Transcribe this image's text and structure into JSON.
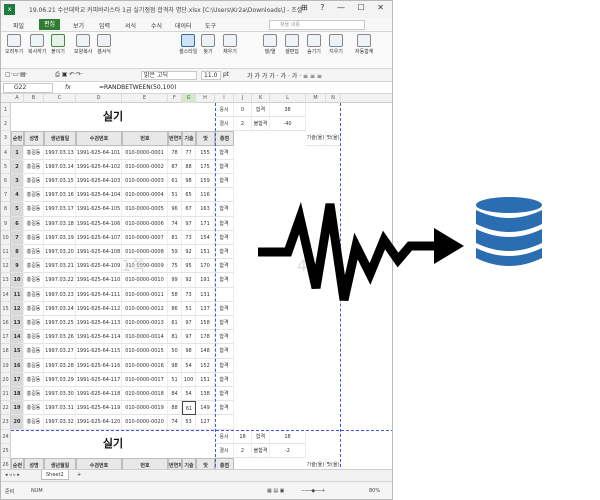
{
  "window": {
    "title": "19.06.21 수산대학교 커피바리스타 1급 실기점점 합격자 명단.xlsx [C:\\Users\\Kr2a\\Downloads\\] - 조셀",
    "logo": "x",
    "controls": "⊞ ? — ☐ ✕"
  },
  "menu": {
    "items": [
      "파일",
      "편집",
      "보기",
      "입력",
      "서식",
      "수식",
      "데이터",
      "도구"
    ],
    "active_index": 1,
    "quick_placeholder": "찾을 내용"
  },
  "ribbon": {
    "buttons": [
      "오려두기",
      "복사하기",
      "붙이기",
      "모양복사",
      "셀서식",
      "셀스타일",
      "찾기",
      "채우기",
      "행/열",
      "셀편집",
      "숨기기",
      "지우기",
      "자동합계"
    ]
  },
  "toolbar": {
    "font": "맑은 고딕",
    "size": "11.0",
    "unit": "pt"
  },
  "formula_bar": {
    "cell_ref": "G22",
    "fx": "fx",
    "formula": "=RANDBETWEEN(50,100)"
  },
  "columns": [
    "A",
    "B",
    "C",
    "D",
    "E",
    "F",
    "G",
    "H",
    "I",
    "J",
    "K",
    "L",
    "M",
    "N"
  ],
  "sheet": {
    "title": "실기",
    "watermark_left": "1쪽",
    "watermark_right": "4쪽",
    "side_labels": {
      "r1": [
        "응시",
        "0",
        "합격",
        "38"
      ],
      "r2": [
        "결시",
        "2",
        "불합격",
        "-40"
      ],
      "r3": [
        "기술(율)",
        "맛(율)"
      ]
    },
    "headers": [
      "순번",
      "성명",
      "생년월일",
      "수검번호",
      "번호",
      "번연처",
      "기술",
      "맛",
      "총점"
    ],
    "rows": [
      [
        "1",
        "홍길동",
        "1997.03.13",
        "1991-625-64-101",
        "010-0000-0001",
        "78",
        "77",
        "155",
        "합격"
      ],
      [
        "2",
        "홍길동",
        "1997.03.14",
        "1991-625-64-102",
        "010-0000-0002",
        "87",
        "88",
        "175",
        "합격"
      ],
      [
        "3",
        "홍길동",
        "1997.03.15",
        "1991-625-64-103",
        "010-0000-0003",
        "61",
        "98",
        "159",
        "합격"
      ],
      [
        "4",
        "홍길동",
        "1997.03.16",
        "1991-625-64-104",
        "010-0000-0004",
        "51",
        "65",
        "116",
        ""
      ],
      [
        "5",
        "홍길동",
        "1997.03.17",
        "1991-625-64-105",
        "010-0000-0005",
        "96",
        "67",
        "163",
        "합격"
      ],
      [
        "6",
        "홍길동",
        "1997.03.18",
        "1991-625-64-106",
        "010-0000-0006",
        "74",
        "97",
        "171",
        "합격"
      ],
      [
        "7",
        "홍길동",
        "1997.03.19",
        "1991-625-64-107",
        "010-0000-0007",
        "81",
        "73",
        "154",
        "합격"
      ],
      [
        "8",
        "홍길동",
        "1997.03.20",
        "1991-625-64-108",
        "010-0000-0008",
        "59",
        "92",
        "151",
        "합격"
      ],
      [
        "9",
        "홍길동",
        "1997.03.21",
        "1991-625-64-109",
        "010-0000-0009",
        "75",
        "95",
        "170",
        "합격"
      ],
      [
        "10",
        "홍길동",
        "1997.03.22",
        "1991-625-64-110",
        "010-0000-0010",
        "99",
        "92",
        "191",
        "합격"
      ],
      [
        "11",
        "홍길동",
        "1997.03.23",
        "1991-625-64-111",
        "010-0000-0011",
        "58",
        "73",
        "131",
        ""
      ],
      [
        "12",
        "홍길동",
        "1997.03.24",
        "1991-625-64-112",
        "010-0000-0012",
        "86",
        "51",
        "137",
        "합격"
      ],
      [
        "13",
        "홍길동",
        "1997.03.25",
        "1991-625-64-113",
        "010-0000-0013",
        "61",
        "97",
        "158",
        "합격"
      ],
      [
        "14",
        "홍길동",
        "1997.03.26",
        "1991-625-64-114",
        "010-0000-0014",
        "81",
        "97",
        "178",
        "합격"
      ],
      [
        "15",
        "홍길동",
        "1997.03.27",
        "1991-625-64-115",
        "010-0000-0015",
        "50",
        "98",
        "148",
        "합격"
      ],
      [
        "16",
        "홍길동",
        "1997.03.28",
        "1991-625-64-116",
        "010-0000-0016",
        "98",
        "54",
        "152",
        "합격"
      ],
      [
        "17",
        "홍길동",
        "1997.03.29",
        "1991-625-64-117",
        "010-0000-0017",
        "51",
        "100",
        "151",
        "합격"
      ],
      [
        "18",
        "홍길동",
        "1997.03.30",
        "1991-625-64-118",
        "010-0000-0018",
        "84",
        "54",
        "138",
        "합격"
      ],
      [
        "19",
        "홍길동",
        "1997.03.31",
        "1991-625-64-119",
        "010-0000-0019",
        "88",
        "61",
        "149",
        "합격"
      ],
      [
        "20",
        "홍길동",
        "1997.03.32",
        "1991-625-64-120",
        "010-0000-0020",
        "74",
        "53",
        "127",
        ""
      ]
    ],
    "title2": "실기",
    "side_labels2": {
      "r1": [
        "응시",
        "18",
        "합격",
        "18"
      ],
      "r2": [
        "결시",
        "2",
        "불합격",
        "-2"
      ],
      "r3": [
        "기술(율)",
        "맛(율)"
      ]
    },
    "row_numbers": [
      "1",
      "2",
      "3",
      "4",
      "5",
      "6",
      "7",
      "8",
      "9",
      "10",
      "11",
      "12",
      "13",
      "14",
      "15",
      "16",
      "17",
      "18",
      "19",
      "20",
      "21",
      "22",
      "23",
      "24",
      "25",
      "26"
    ]
  },
  "sheet_tabs": {
    "active": "Sheet2",
    "add": "+"
  },
  "status": {
    "mode": "준비",
    "num": "NUM",
    "zoom": "80%"
  },
  "graphic": {
    "arrow_color": "#000000",
    "db_color": "#2a6db0"
  }
}
